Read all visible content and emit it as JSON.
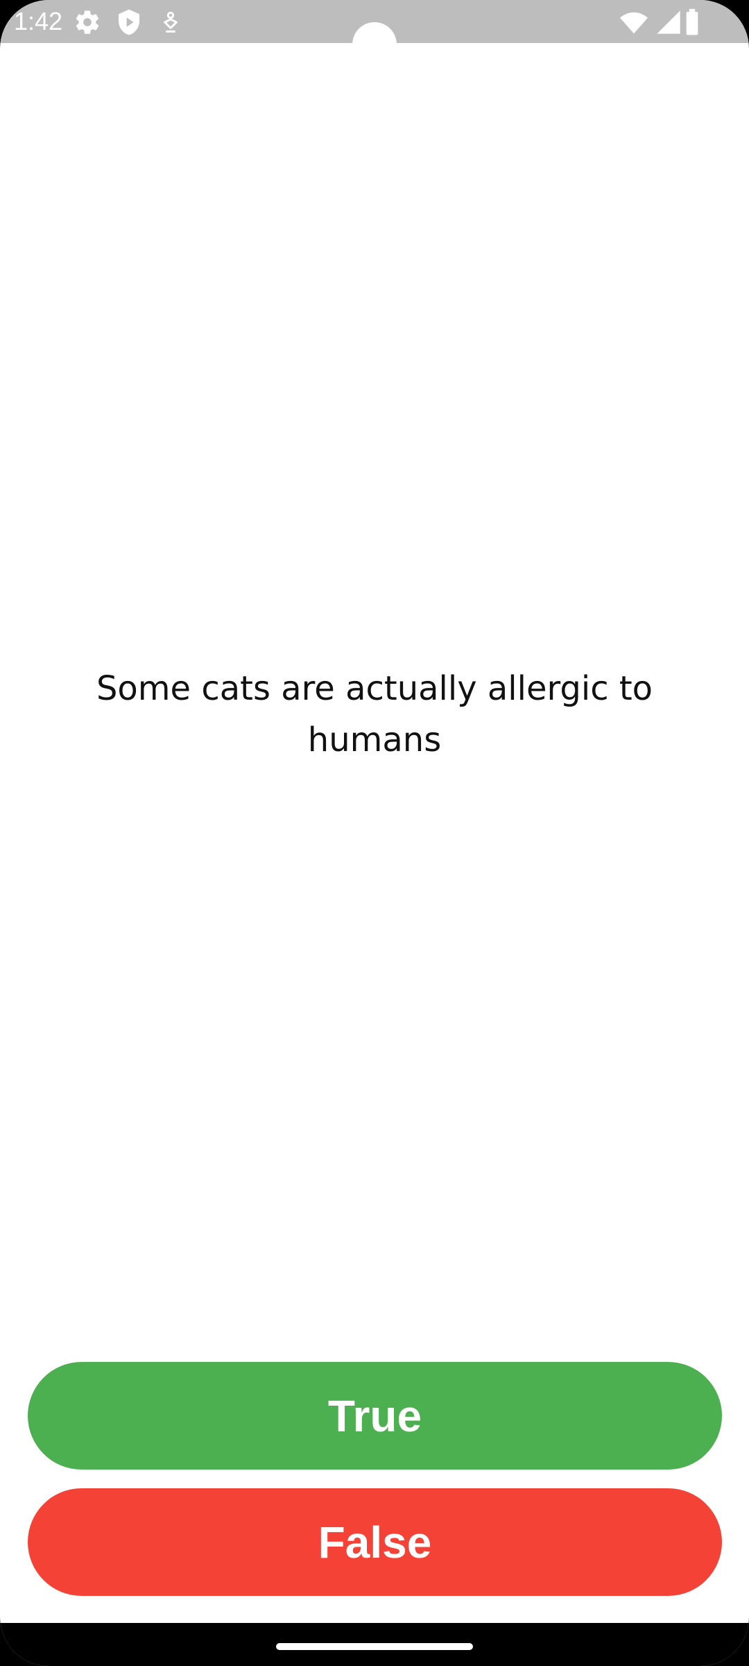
{
  "status_bar": {
    "time": "1:42",
    "icons": [
      "settings-icon",
      "shield-play-icon",
      "accessibility-icon",
      "wifi-icon",
      "signal-icon",
      "battery-icon"
    ]
  },
  "question": {
    "text": "Some cats are actually allergic to humans"
  },
  "buttons": {
    "true_label": "True",
    "false_label": "False"
  },
  "colors": {
    "status_bar": "#bdbdbd",
    "true_button": "#4caf50",
    "false_button": "#f44336",
    "background": "#ffffff"
  }
}
